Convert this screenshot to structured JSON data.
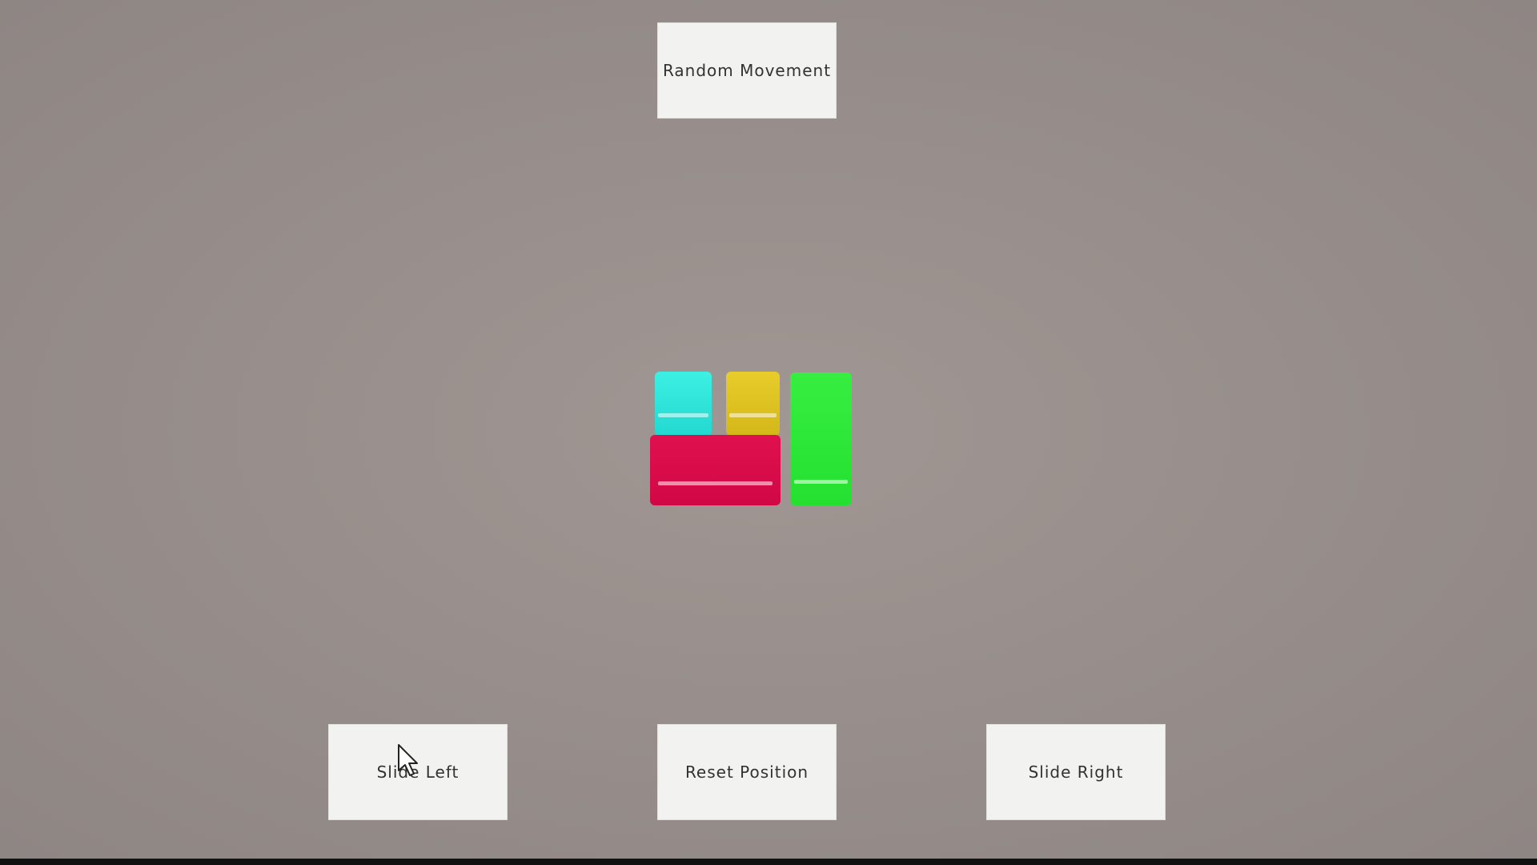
{
  "buttons": {
    "random_movement": "Random Movement",
    "slide_left": "Slide Left",
    "reset_position": "Reset Position",
    "slide_right": "Slide Right"
  },
  "colors": {
    "background": "#988f8c",
    "button": "#f2f2f0",
    "button_text": "#323232",
    "block_cyan": "#2ee6da",
    "block_yellow": "#dfc222",
    "block_green": "#2ee838",
    "block_red": "#d90a4a"
  },
  "icons": {
    "cursor": "mouse-pointer-icon"
  }
}
